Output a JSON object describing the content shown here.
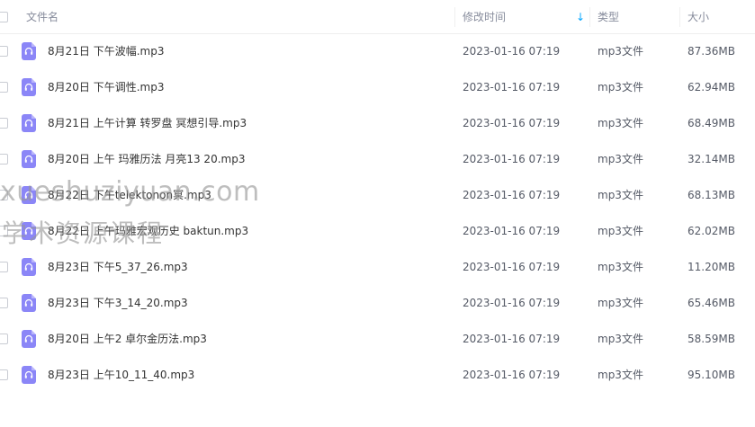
{
  "header": {
    "name": "文件名",
    "modified": "修改时间",
    "sort_arrow": "↓",
    "type": "类型",
    "size": "大小"
  },
  "icon": "audio-headphones-icon",
  "files": [
    {
      "name": "8月21日 下午波幅.mp3",
      "time": "2023-01-16 07:19",
      "type": "mp3文件",
      "size": "87.36MB"
    },
    {
      "name": "8月20日 下午调性.mp3",
      "time": "2023-01-16 07:19",
      "type": "mp3文件",
      "size": "62.94MB"
    },
    {
      "name": "8月21日 上午计算 转罗盘 冥想引导.mp3",
      "time": "2023-01-16 07:19",
      "type": "mp3文件",
      "size": "68.49MB"
    },
    {
      "name": "8月20日 上午 玛雅历法 月亮13 20.mp3",
      "time": "2023-01-16 07:19",
      "type": "mp3文件",
      "size": "32.14MB"
    },
    {
      "name": "8月22日 下午telektonon冥.mp3",
      "time": "2023-01-16 07:19",
      "type": "mp3文件",
      "size": "68.13MB"
    },
    {
      "name": "8月22日 上午玛雅宏观历史 baktun.mp3",
      "time": "2023-01-16 07:19",
      "type": "mp3文件",
      "size": "62.02MB"
    },
    {
      "name": "8月23日 下午5_37_26.mp3",
      "time": "2023-01-16 07:19",
      "type": "mp3文件",
      "size": "11.20MB"
    },
    {
      "name": "8月23日 下午3_14_20.mp3",
      "time": "2023-01-16 07:19",
      "type": "mp3文件",
      "size": "65.46MB"
    },
    {
      "name": "8月20日 上午2 卓尔金历法.mp3",
      "time": "2023-01-16 07:19",
      "type": "mp3文件",
      "size": "58.59MB"
    },
    {
      "name": "8月23日 上午10_11_40.mp3",
      "time": "2023-01-16 07:19",
      "type": "mp3文件",
      "size": "95.10MB"
    }
  ],
  "watermark": {
    "line1": "xueshuziyuan.com",
    "line2": "学术资源课程"
  }
}
